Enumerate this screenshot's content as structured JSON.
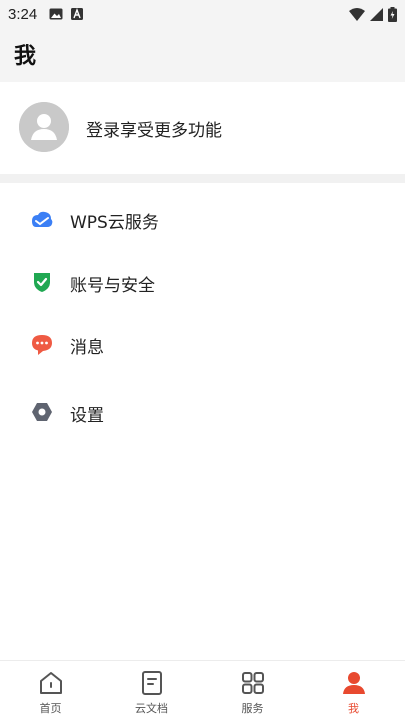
{
  "status_bar": {
    "time": "3:24",
    "left_icons": [
      "image-icon",
      "a-badge-icon"
    ],
    "right_icons": [
      "wifi-icon",
      "signal-icon",
      "battery-icon"
    ]
  },
  "header": {
    "title": "我"
  },
  "profile": {
    "login_prompt": "登录享受更多功能",
    "avatar_icon": "person-avatar-icon"
  },
  "menu": {
    "items": [
      {
        "label": "WPS云服务",
        "icon": "cloud-icon",
        "color": "#3b7ff5"
      },
      {
        "label": "账号与安全",
        "icon": "shield-check-icon",
        "color": "#20a852"
      },
      {
        "label": "消息",
        "icon": "message-bubble-icon",
        "color": "#ef5a43"
      },
      {
        "label": "设置",
        "icon": "settings-hex-icon",
        "color": "#5f6470"
      }
    ]
  },
  "tabbar": {
    "tabs": [
      {
        "label": "首页",
        "icon": "home-icon",
        "active": false
      },
      {
        "label": "云文档",
        "icon": "cloud-doc-icon",
        "active": false
      },
      {
        "label": "服务",
        "icon": "grid-icon",
        "active": false
      },
      {
        "label": "我",
        "icon": "profile-icon",
        "active": true
      }
    ],
    "active_color": "#e8492f"
  }
}
